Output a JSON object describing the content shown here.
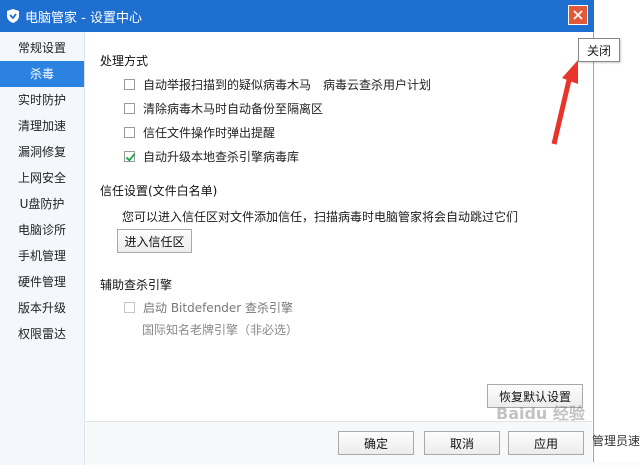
{
  "window": {
    "title": "电脑管家 - 设置中心"
  },
  "sidebar": {
    "items": [
      {
        "label": "常规设置"
      },
      {
        "label": "杀毒"
      },
      {
        "label": "实时防护"
      },
      {
        "label": "清理加速"
      },
      {
        "label": "漏洞修复"
      },
      {
        "label": "上网安全"
      },
      {
        "label": "U盘防护"
      },
      {
        "label": "电脑诊所"
      },
      {
        "label": "手机管理"
      },
      {
        "label": "硬件管理"
      },
      {
        "label": "版本升级"
      },
      {
        "label": "权限雷达"
      }
    ],
    "active_index": 1
  },
  "scan": {
    "title": "处理方式",
    "options": [
      {
        "label": "自动举报扫描到的疑似病毒木马",
        "extra": "病毒云查杀用户计划",
        "checked": false
      },
      {
        "label": "清除病毒木马时自动备份至隔离区",
        "checked": false
      },
      {
        "label": "信任文件操作时弹出提醒",
        "checked": false
      },
      {
        "label": "自动升级本地查杀引擎病毒库",
        "checked": true
      }
    ]
  },
  "trust": {
    "title": "信任设置(文件白名单)",
    "description": "您可以进入信任区对文件添加信任，扫描病毒时电脑管家将会自动跳过它们",
    "button": "进入信任区"
  },
  "engine": {
    "title": "辅助查杀引擎",
    "option_label": "启动 Bitdefender 查杀引擎",
    "option_checked": false,
    "note": "国际知名老牌引擎（非必选）"
  },
  "buttons": {
    "restore": "恢复默认设置",
    "ok": "确定",
    "cancel": "取消",
    "apply": "应用"
  },
  "tooltip": {
    "close": "关闭"
  },
  "watermark": {
    "text": "Baidu 经验",
    "right_text": "管理员速"
  },
  "colors": {
    "titlebar": "#1f6fd0",
    "active": "#2b82e0",
    "close": "#e05a3a",
    "arrow": "#e8352b"
  }
}
